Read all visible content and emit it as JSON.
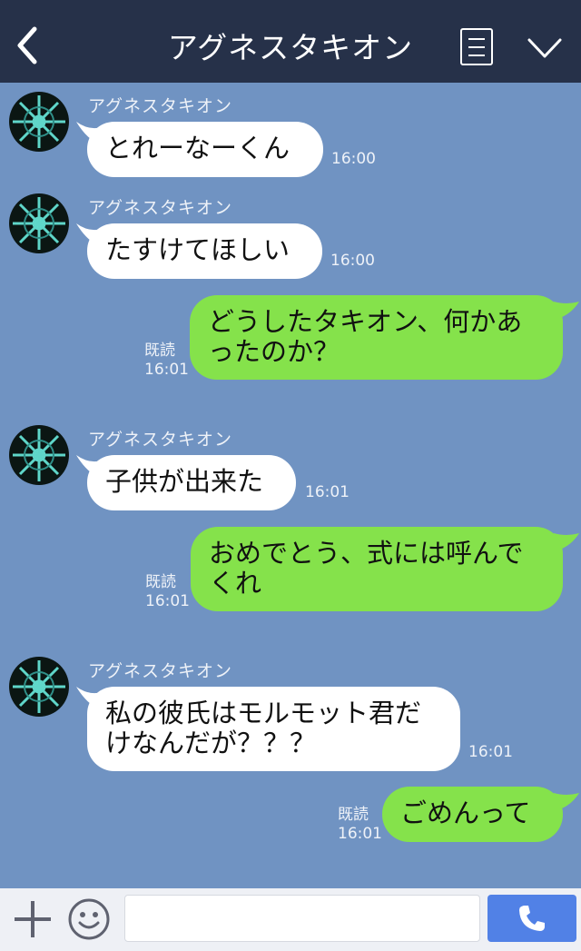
{
  "header": {
    "title": "アグネスタキオン"
  },
  "messages": [
    {
      "sender": "アグネスタキオン",
      "text": "とれーなーくん",
      "time": "16:00"
    },
    {
      "sender": "アグネスタキオン",
      "text": "たすけてほしい",
      "time": "16:00"
    },
    {
      "text": "どうしたタキオン、何かあ\nったのか？",
      "read": "既読",
      "time": "16:01"
    },
    {
      "sender": "アグネスタキオン",
      "text": "子供が出来た",
      "time": "16:01"
    },
    {
      "text": "おめでとう、式には呼んで\nくれ",
      "read": "既読",
      "time": "16:01"
    },
    {
      "sender": "アグネスタキオン",
      "text": "私の彼氏はモルモット君だ\nけなんだが？？？",
      "time": "16:01"
    },
    {
      "text": "ごめんって",
      "read": "既読",
      "time": "16:01"
    }
  ],
  "colors": {
    "background": "#7093c2",
    "header": "#263149",
    "outgoing_bubble": "#85e24b",
    "incoming_bubble": "#ffffff",
    "call_button": "#5181e6"
  },
  "icons": [
    "back-arrow-icon",
    "menu-icon",
    "chevron-down-icon",
    "plus-icon",
    "smiley-icon",
    "phone-icon"
  ]
}
